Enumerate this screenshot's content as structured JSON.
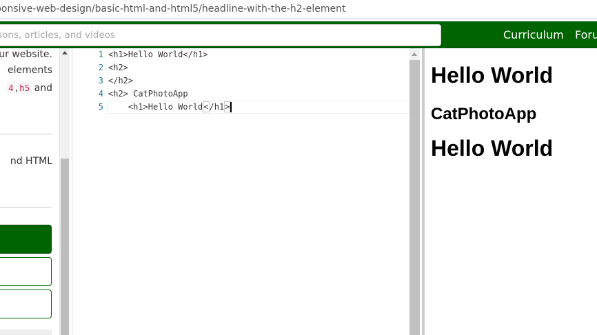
{
  "browser": {
    "url": "ponsive-web-design/basic-html-and-html5/headline-with-the-h2-element"
  },
  "nav": {
    "search_placeholder": "ssons, articles, and videos",
    "links": [
      "Curriculum",
      "Foru"
    ],
    "accent_color": "#006400"
  },
  "instructions": {
    "line1": "ur website.",
    "line2": "elements",
    "code1": "4",
    "comma": ",",
    "code2": "h5",
    "line3_end": " and",
    "line4": "nd HTML"
  },
  "editor": {
    "line_numbers": [
      "1",
      "2",
      "3",
      "4",
      "5"
    ],
    "lines": [
      "<h1>Hello World</h1>",
      "<h2>",
      "</h2>",
      "<h2> CatPhotoApp",
      "    <h1>Hello World</h1>"
    ],
    "line5": {
      "before": "    <h1>Hello World",
      "bracket_open": "<",
      "middle": "/h1",
      "bracket_close": ">"
    },
    "line_number_color": "#237893"
  },
  "preview": {
    "heading1": "Hello World",
    "heading2": "CatPhotoApp",
    "heading3": "Hello World"
  }
}
